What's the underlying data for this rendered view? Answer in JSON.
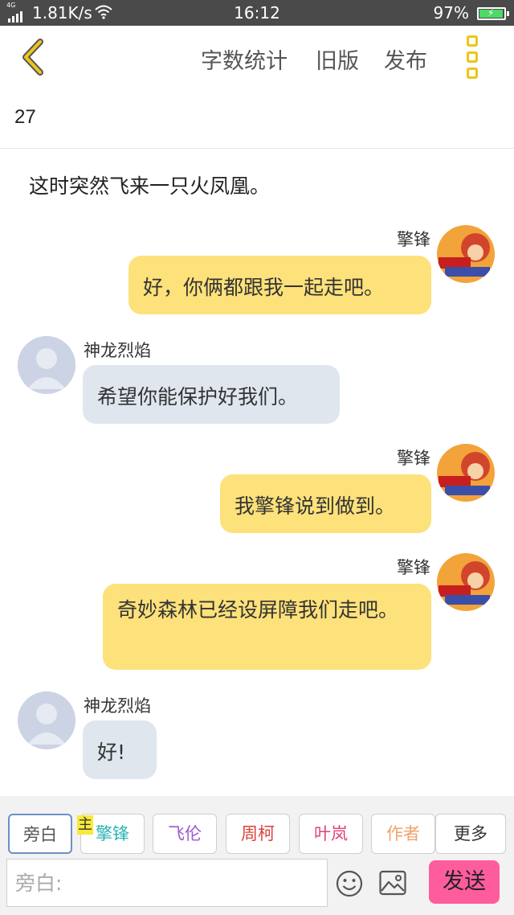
{
  "status_bar": {
    "network": "4G",
    "speed": "1.81K/s",
    "time": "16:12",
    "battery": "97%",
    "battery_level": 0.97,
    "battery_color": "#4cd964"
  },
  "topnav": {
    "back_icon": "chevron-left-icon",
    "word_count_label": "字数统计",
    "old_version_label": "旧版",
    "publish_label": "发布",
    "more_icon": "more-vertical-icon",
    "accent_color": "#f0c419"
  },
  "chapter": {
    "number": "27"
  },
  "chat": {
    "narration": "这时突然飞来一只火凤凰。",
    "messages": [
      {
        "speaker": "擎锋",
        "side": "right",
        "text": "好，你俩都跟我一起走吧。"
      },
      {
        "speaker": "神龙烈焰",
        "side": "left",
        "text": "希望你能保护好我们。"
      },
      {
        "speaker": "擎锋",
        "side": "right",
        "text": "我擎锋说到做到。"
      },
      {
        "speaker": "擎锋",
        "side": "right",
        "text": "奇妙森林已经设屏障我们走吧。"
      },
      {
        "speaker": "神龙烈焰",
        "side": "left",
        "text": "好!"
      }
    ],
    "right_bubble_color": "#fde17a",
    "left_bubble_color": "#dfe6ee"
  },
  "characters": {
    "main_tag": "主",
    "chips": [
      {
        "label": "旁白",
        "color": "#555555"
      },
      {
        "label": "擎锋",
        "color": "#2bb3b8"
      },
      {
        "label": "飞伦",
        "color": "#9b59d0"
      },
      {
        "label": "周柯",
        "color": "#d9443f"
      },
      {
        "label": "叶岚",
        "color": "#e0407d"
      },
      {
        "label": "作者",
        "color": "#f0a36a"
      },
      {
        "label": "更多",
        "color": "#333333"
      }
    ]
  },
  "composer": {
    "placeholder": "旁白:",
    "emoji_icon": "emoji-icon",
    "image_icon": "image-icon",
    "send_label": "发送",
    "send_color": "#ff5c9e"
  }
}
